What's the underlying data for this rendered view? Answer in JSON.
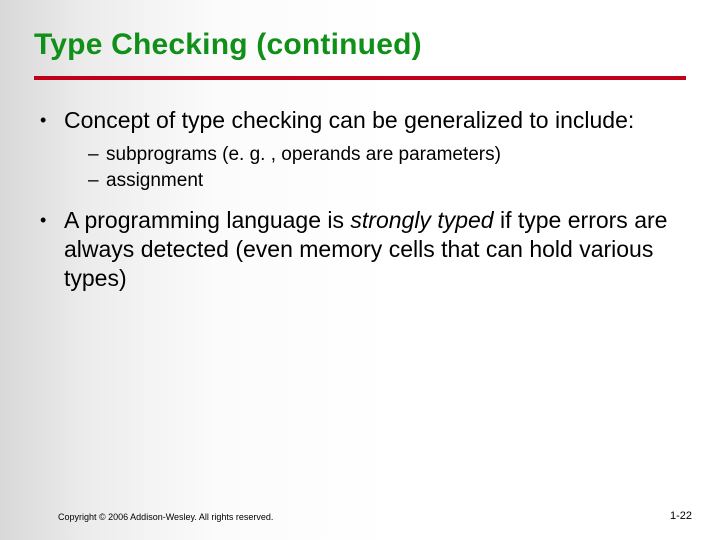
{
  "title": "Type Checking (continued)",
  "bullets": {
    "b1": {
      "text": "Concept of type checking can be generalized to include:",
      "subs": {
        "s1": "subprograms (e. g. , operands are parameters)",
        "s2": "assignment"
      }
    },
    "b2": {
      "prefix": "A programming language is ",
      "em": "strongly typed",
      "suffix": " if type errors are always detected (even memory cells that can hold various types)"
    }
  },
  "footer": {
    "copyright": "Copyright © 2006 Addison-Wesley. All rights reserved.",
    "page": "1-22"
  }
}
